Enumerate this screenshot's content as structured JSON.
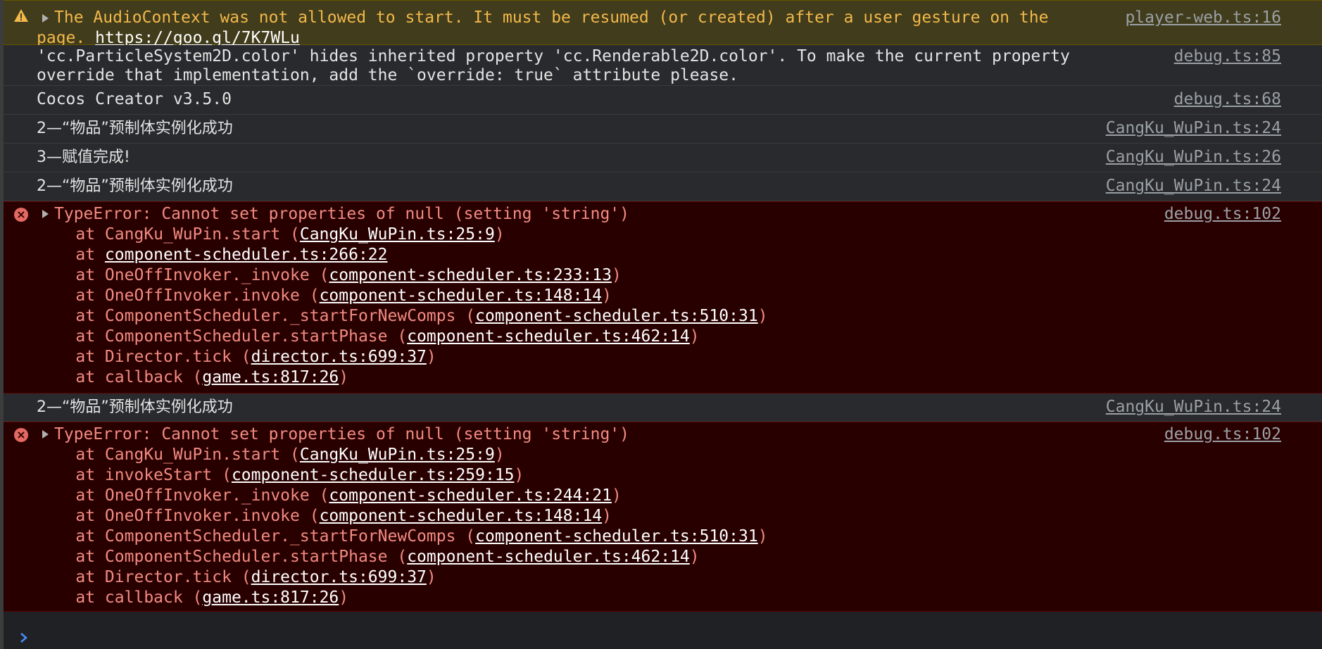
{
  "messages": [
    {
      "type": "warning",
      "icon": "warning-icon",
      "text_1": "The AudioContext was not allowed to start. It must be resumed (or created) after a user gesture on the",
      "text_2": "page. ",
      "link": "https://goo.gl/7K7WLu",
      "source": "player-web.ts:16"
    },
    {
      "type": "log",
      "text_1": "'cc.ParticleSystem2D.color' hides inherited property 'cc.Renderable2D.color'. To make the current property",
      "text_2": "override that implementation, add the `override: true` attribute please.",
      "source": "debug.ts:85"
    },
    {
      "type": "log",
      "text": "Cocos Creator v3.5.0",
      "source": "debug.ts:68"
    },
    {
      "type": "log",
      "text": "2—“物品”预制体实例化成功",
      "source": "CangKu_WuPin.ts:24"
    },
    {
      "type": "log",
      "text": "3—赋值完成!",
      "source": "CangKu_WuPin.ts:26"
    },
    {
      "type": "log",
      "text": "2—“物品”预制体实例化成功",
      "source": "CangKu_WuPin.ts:24"
    },
    {
      "type": "error",
      "icon": "error-icon",
      "text": "TypeError: Cannot set properties of null (setting 'string')",
      "source": "debug.ts:102",
      "stack": [
        {
          "prefix": "    at CangKu_WuPin.start (",
          "link": "CangKu_WuPin.ts:25:9",
          "suffix": ")"
        },
        {
          "prefix": "    at ",
          "link": "component-scheduler.ts:266:22",
          "suffix": ""
        },
        {
          "prefix": "    at OneOffInvoker._invoke (",
          "link": "component-scheduler.ts:233:13",
          "suffix": ")"
        },
        {
          "prefix": "    at OneOffInvoker.invoke (",
          "link": "component-scheduler.ts:148:14",
          "suffix": ")"
        },
        {
          "prefix": "    at ComponentScheduler._startForNewComps (",
          "link": "component-scheduler.ts:510:31",
          "suffix": ")"
        },
        {
          "prefix": "    at ComponentScheduler.startPhase (",
          "link": "component-scheduler.ts:462:14",
          "suffix": ")"
        },
        {
          "prefix": "    at Director.tick (",
          "link": "director.ts:699:37",
          "suffix": ")"
        },
        {
          "prefix": "    at callback (",
          "link": "game.ts:817:26",
          "suffix": ")"
        }
      ]
    },
    {
      "type": "log",
      "text": "2—“物品”预制体实例化成功",
      "source": "CangKu_WuPin.ts:24"
    },
    {
      "type": "error",
      "icon": "error-icon",
      "text": "TypeError: Cannot set properties of null (setting 'string')",
      "source": "debug.ts:102",
      "stack": [
        {
          "prefix": "    at CangKu_WuPin.start (",
          "link": "CangKu_WuPin.ts:25:9",
          "suffix": ")"
        },
        {
          "prefix": "    at invokeStart (",
          "link": "component-scheduler.ts:259:15",
          "suffix": ")"
        },
        {
          "prefix": "    at OneOffInvoker._invoke (",
          "link": "component-scheduler.ts:244:21",
          "suffix": ")"
        },
        {
          "prefix": "    at OneOffInvoker.invoke (",
          "link": "component-scheduler.ts:148:14",
          "suffix": ")"
        },
        {
          "prefix": "    at ComponentScheduler._startForNewComps (",
          "link": "component-scheduler.ts:510:31",
          "suffix": ")"
        },
        {
          "prefix": "    at ComponentScheduler.startPhase (",
          "link": "component-scheduler.ts:462:14",
          "suffix": ")"
        },
        {
          "prefix": "    at Director.tick (",
          "link": "director.ts:699:37",
          "suffix": ")"
        },
        {
          "prefix": "    at callback (",
          "link": "game.ts:817:26",
          "suffix": ")"
        }
      ]
    }
  ],
  "prompt": {
    "icon": "chevron-right-icon",
    "value": ""
  },
  "colors": {
    "background": "#202124",
    "warning_bg": "#413c1b",
    "warning_text": "#f2b84b",
    "error_bg": "#290000",
    "error_text": "#f28b82",
    "source_link": "#9aa0a6",
    "prompt_accent": "#4a8cff"
  }
}
